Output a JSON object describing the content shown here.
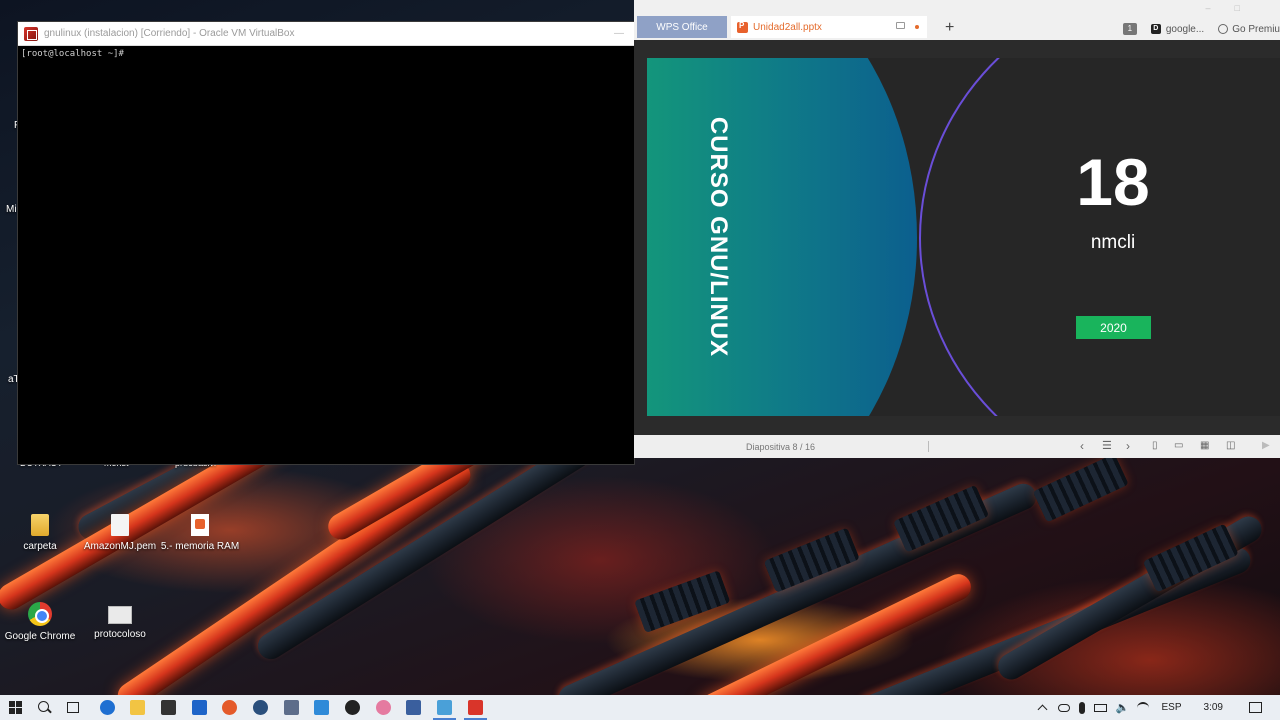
{
  "desktop": {
    "icons": [
      {
        "id": "carpeta",
        "label": "carpeta",
        "kind": "folder"
      },
      {
        "id": "amazon",
        "label": "AmazonMJ.pem",
        "kind": "file"
      },
      {
        "id": "memoria",
        "label": "5.- memoria RAM",
        "kind": "ppt"
      },
      {
        "id": "chrome",
        "label": "Google Chrome",
        "kind": "chrome"
      },
      {
        "id": "protocoloso",
        "label": "protocoloso",
        "kind": "image"
      }
    ],
    "partial_labels": [
      "Fi",
      "Mi",
      "aT",
      "DUTXAUT",
      "monst",
      "pruebasivi"
    ]
  },
  "vbox": {
    "title": "gnulinux (instalacion) [Corriendo] - Oracle VM VirtualBox",
    "minimize_glyph": "—",
    "terminal_line": "[root@localhost ~]#"
  },
  "wps": {
    "home_tab": "WPS Office",
    "doc_tab": "Unidad2all.pptx",
    "new_tab_glyph": "+",
    "tab_count": "1",
    "account": "google...",
    "premium": "Go Premiu",
    "slide": {
      "vertical_title": "CURSO GNU/LINUX",
      "number": "18",
      "subtitle": "nmcli",
      "year": "2020"
    },
    "status": {
      "slide_counter": "Diapositiva  8 / 16"
    }
  },
  "taskbar": {
    "lang": "ESP",
    "time": "3:09"
  },
  "colors": {
    "accent_green": "#19b45c",
    "ring_purple": "#6a4ed8",
    "wps_tab": "#8fa1c6",
    "ppt_orange": "#e8612c"
  }
}
